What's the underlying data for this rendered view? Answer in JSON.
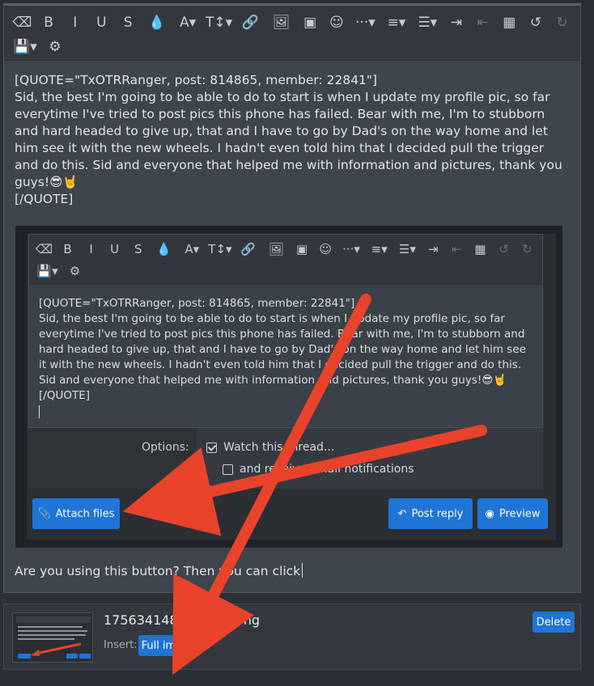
{
  "toolbar": {
    "row1": [
      {
        "icon": "eraser-icon",
        "glyph": "⌫"
      },
      {
        "icon": "bold-icon",
        "glyph": "B"
      },
      {
        "icon": "italic-icon",
        "glyph": "I"
      },
      {
        "icon": "underline-icon",
        "glyph": "U"
      },
      {
        "icon": "strikethrough-icon",
        "glyph": "S"
      },
      {
        "icon": "color-drop-icon",
        "glyph": "💧"
      },
      {
        "icon": "font-family-icon",
        "glyph": "A▾"
      },
      {
        "icon": "font-size-icon",
        "glyph": "T↕▾"
      },
      {
        "icon": "link-icon",
        "glyph": "🔗"
      },
      {
        "icon": "image-icon",
        "glyph": "🖼"
      },
      {
        "icon": "video-icon",
        "glyph": "▣"
      },
      {
        "icon": "emoji-icon",
        "glyph": "☺"
      },
      {
        "icon": "more-icon",
        "glyph": "···▾"
      },
      {
        "icon": "align-icon",
        "glyph": "≡▾"
      },
      {
        "icon": "list-icon",
        "glyph": "☰▾"
      },
      {
        "icon": "indent-icon",
        "glyph": "⇥"
      },
      {
        "icon": "outdent-icon",
        "glyph": "⇤"
      },
      {
        "icon": "table-icon",
        "glyph": "▦"
      },
      {
        "icon": "undo-icon",
        "glyph": "↺"
      },
      {
        "icon": "redo-icon",
        "glyph": "↻"
      }
    ],
    "row2": [
      {
        "icon": "save-draft-icon",
        "glyph": "💾▾"
      },
      {
        "icon": "settings-icon",
        "glyph": "⚙"
      }
    ]
  },
  "editor": {
    "quote_open": "[QUOTE=\"TxOTRRanger, post: 814865, member: 22841\"]",
    "quote_body": "Sid, the best I'm going to be able to do to start is when I update my profile pic, so far everytime I've tried to post pics this phone has failed. Bear with me, I'm to stubborn and hard headed to give up, that and I have to go by Dad's on the way home and let him see it with the new wheels. I hadn't even told him that I decided pull the trigger and do this. Sid and everyone that helped me with information and pictures, thank you guys!😎🤘",
    "quote_close": "[/QUOTE]",
    "typed_text": "Are you using this button? Then you can click"
  },
  "screenshot": {
    "quote_open": "[QUOTE=\"TxOTRRanger, post: 814865, member: 22841\"]",
    "quote_body": "Sid, the best I'm going to be able to do to start is when I update my profile pic, so far everytime I've tried to post pics this phone has failed. Bear with me, I'm to stubborn and hard headed to give up, that and I have to go by Dad's on the way home and let him see it with the new wheels. I hadn't even told him that I decided pull the trigger and do this. Sid and everyone that helped me with information and pictures, thank you guys!😎🤘",
    "quote_close": "[/QUOTE]",
    "options_label": "Options:",
    "watch_thread": "Watch this thread...",
    "email_notify": "and receive email notifications",
    "attach_files": "Attach files",
    "post_reply": "Post reply",
    "preview": "Preview"
  },
  "attachment": {
    "filename": "1756341486124-y7.png",
    "insert_label": "Insert:",
    "full_image": "Full image",
    "delete": "Delete"
  },
  "colors": {
    "accent": "#1f74d6",
    "arrow": "#e8432a"
  }
}
